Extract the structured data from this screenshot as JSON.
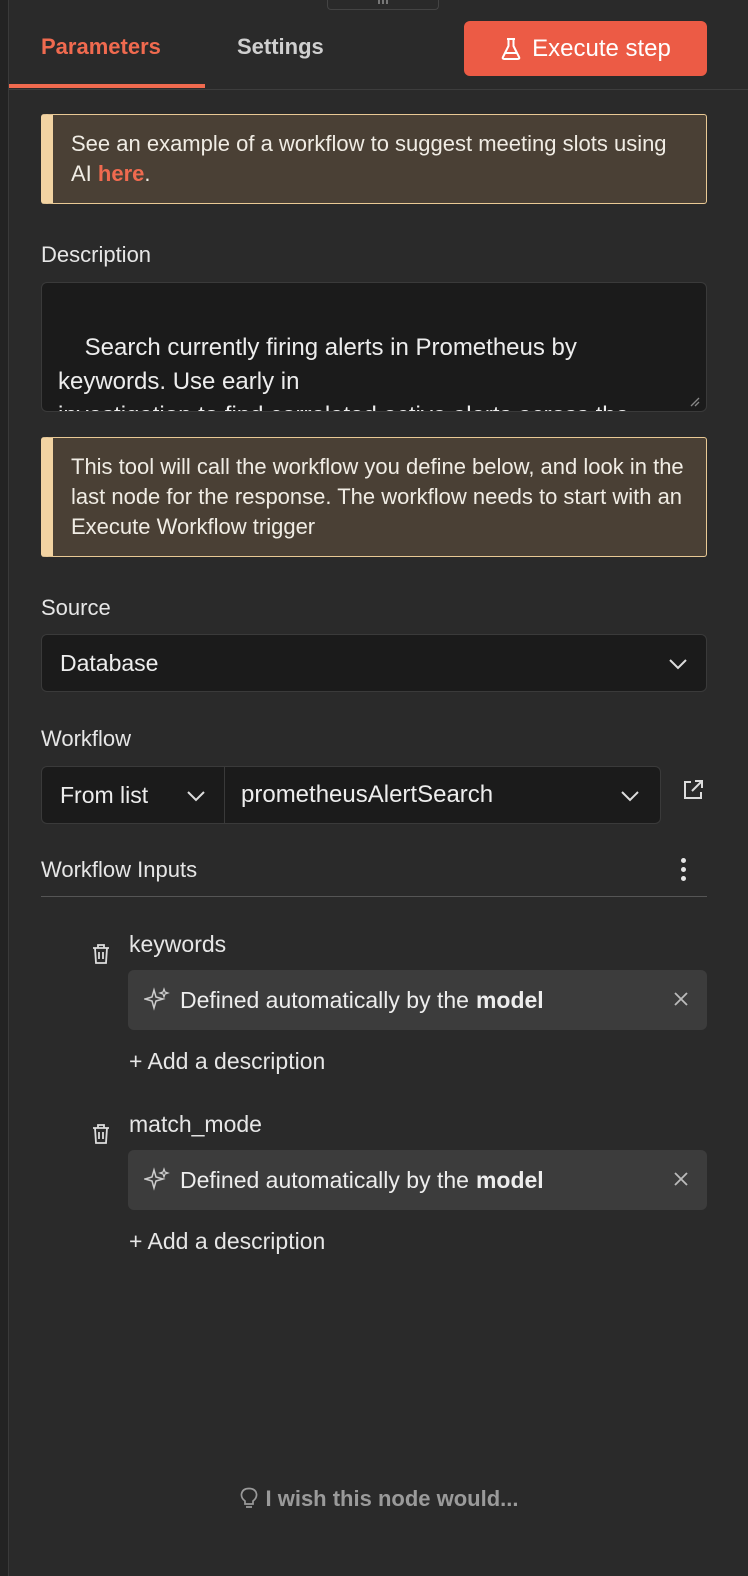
{
  "tabs": {
    "parameters": "Parameters",
    "settings": "Settings"
  },
  "execute_button": "Execute step",
  "example_notice": {
    "text": "See an example of a workflow to suggest meeting slots using AI ",
    "link": "here",
    "suffix": "."
  },
  "description": {
    "label": "Description",
    "value": "Search currently firing alerts in Prometheus by keywords. Use early in\ninvestigation to find correlated active alerts across the platform."
  },
  "tool_notice": "This tool will call the workflow you define below, and look in the last node for the response. The workflow needs to start with an Execute Workflow trigger",
  "source": {
    "label": "Source",
    "value": "Database"
  },
  "workflow": {
    "label": "Workflow",
    "mode": "From list",
    "value": "prometheusAlertSearch"
  },
  "workflow_inputs": {
    "label": "Workflow Inputs",
    "items": [
      {
        "name": "keywords",
        "value_prefix": "Defined automatically by the",
        "value_bold": "model",
        "add_description": "+ Add a description"
      },
      {
        "name": "match_mode",
        "value_prefix": "Defined automatically by the",
        "value_bold": "model",
        "add_description": "+ Add a description"
      }
    ]
  },
  "feedback": "I wish this node would...",
  "colors": {
    "accent": "#ec5b45",
    "panel": "#2a2a2a",
    "notice_bg": "#4a4035",
    "notice_border": "#f2d3a2"
  }
}
